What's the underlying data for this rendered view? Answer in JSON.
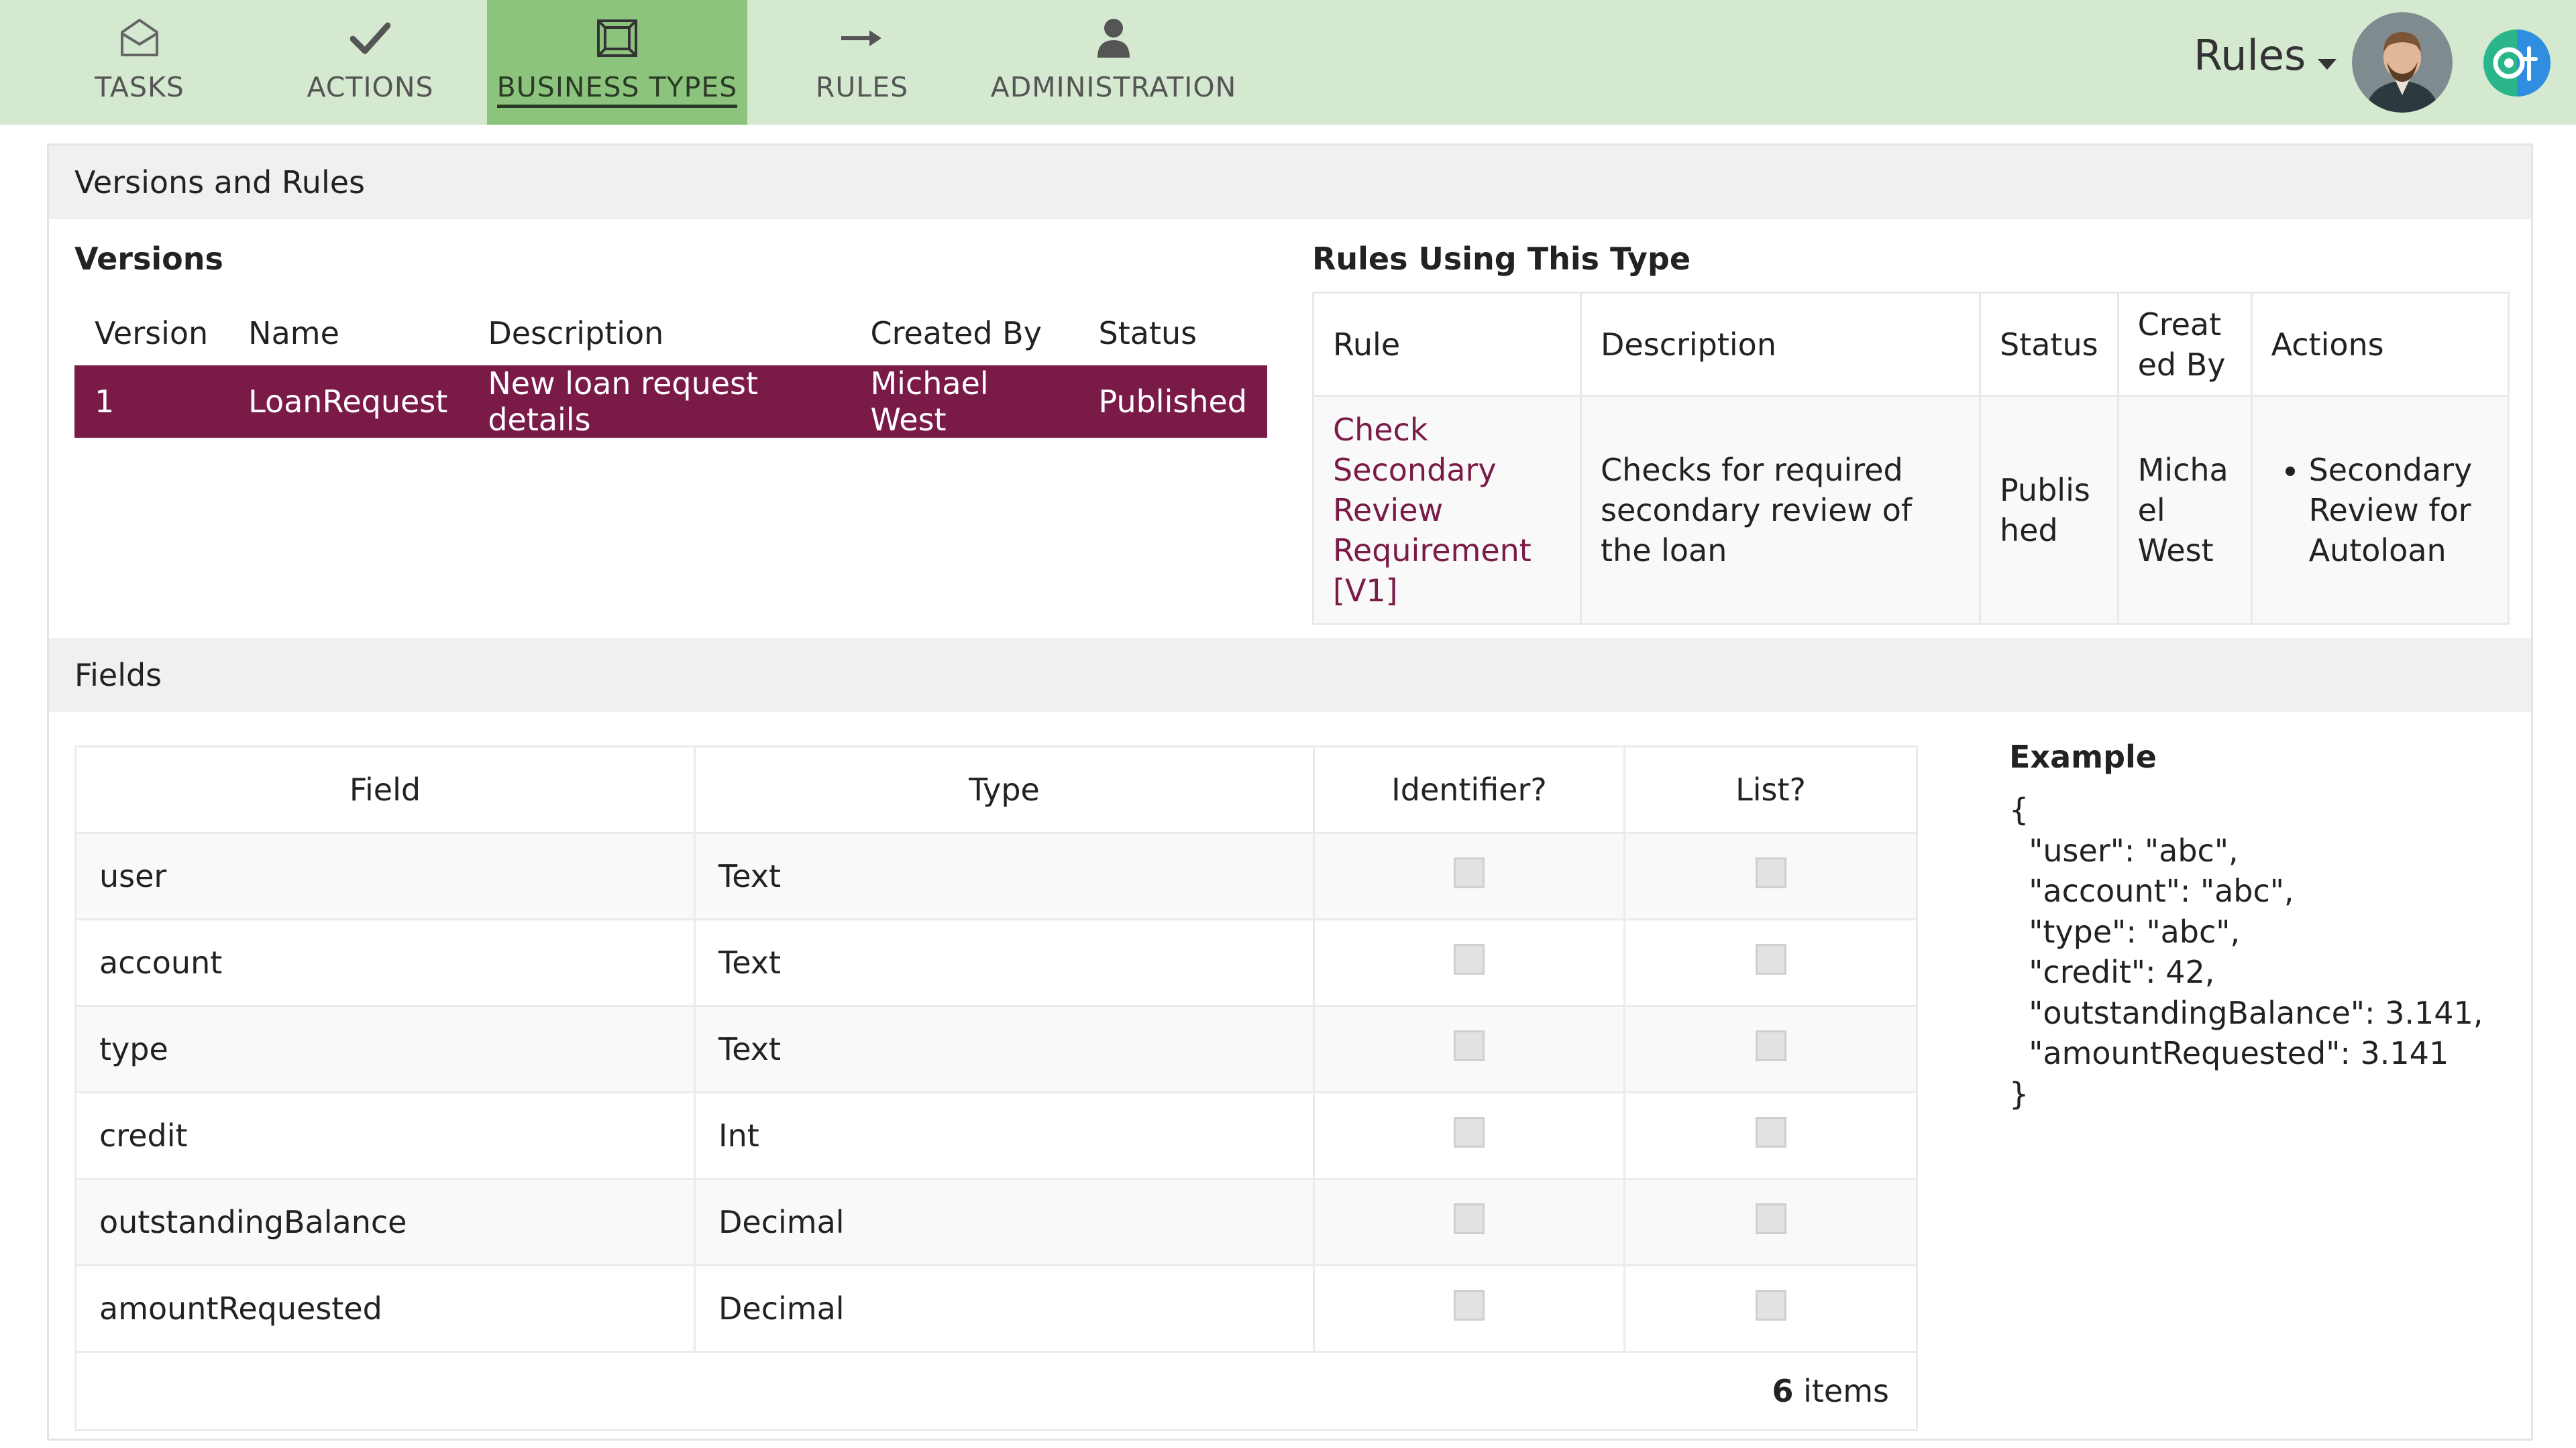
{
  "nav": {
    "items": [
      {
        "label": "TASKS",
        "icon": "inbox-icon",
        "active": false
      },
      {
        "label": "ACTIONS",
        "icon": "checkmark-icon",
        "active": false
      },
      {
        "label": "BUSINESS TYPES",
        "icon": "business-types-icon",
        "active": true
      },
      {
        "label": "RULES",
        "icon": "arrow-right-icon",
        "active": false
      },
      {
        "label": "ADMINISTRATION",
        "icon": "person-icon",
        "active": false
      }
    ],
    "menu_label": "Rules",
    "colors": {
      "bar": "#d4e9d0",
      "active": "#8cc47d",
      "accent": "#7a1a47"
    }
  },
  "versions_panel": {
    "title": "Versions and Rules",
    "versions": {
      "heading": "Versions",
      "columns": [
        "Version",
        "Name",
        "Description",
        "Created By",
        "Status"
      ],
      "rows": [
        {
          "version": "1",
          "name": "LoanRequest",
          "description": "New loan request details",
          "created_by": "Michael West",
          "status": "Published"
        }
      ]
    },
    "rules": {
      "heading": "Rules Using This Type",
      "columns": [
        "Rule",
        "Description",
        "Status",
        "Creat ed By",
        "Actions"
      ],
      "rows": [
        {
          "rule": "Check Secondary Review Requirement [V1]",
          "description": "Checks for required secondary review of the loan",
          "status": "Publis hed",
          "created_by": "Micha el West",
          "actions": [
            "Secondary Review for Autoloan"
          ]
        }
      ]
    }
  },
  "fields_panel": {
    "title": "Fields",
    "columns": [
      "Field",
      "Type",
      "Identifier?",
      "List?"
    ],
    "rows": [
      {
        "field": "user",
        "type": "Text",
        "identifier": false,
        "list": false
      },
      {
        "field": "account",
        "type": "Text",
        "identifier": false,
        "list": false
      },
      {
        "field": "type",
        "type": "Text",
        "identifier": false,
        "list": false
      },
      {
        "field": "credit",
        "type": "Int",
        "identifier": false,
        "list": false
      },
      {
        "field": "outstandingBalance",
        "type": "Decimal",
        "identifier": false,
        "list": false
      },
      {
        "field": "amountRequested",
        "type": "Decimal",
        "identifier": false,
        "list": false
      }
    ],
    "count": "6",
    "count_suffix": " items",
    "example": {
      "title": "Example",
      "code": "{\n  \"user\": \"abc\",\n  \"account\": \"abc\",\n  \"type\": \"abc\",\n  \"credit\": 42,\n  \"outstandingBalance\": 3.141,\n  \"amountRequested\": 3.141\n}"
    }
  }
}
